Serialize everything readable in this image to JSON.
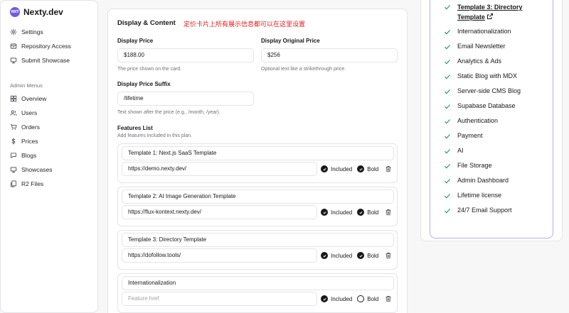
{
  "brand": {
    "name": "Nexty.dev",
    "logo_text": "NXT"
  },
  "sidebar": {
    "top_items": [
      {
        "label": "Settings",
        "icon": "gear-icon"
      },
      {
        "label": "Repository Access",
        "icon": "box-icon"
      },
      {
        "label": "Submit Showcase",
        "icon": "monitor-icon"
      }
    ],
    "section_label": "Admin Menus",
    "admin_items": [
      {
        "label": "Overview",
        "icon": "grid-icon"
      },
      {
        "label": "Users",
        "icon": "users-icon"
      },
      {
        "label": "Orders",
        "icon": "cart-icon"
      },
      {
        "label": "Prices",
        "icon": "dollar-icon"
      },
      {
        "label": "Blogs",
        "icon": "chat-icon"
      },
      {
        "label": "Showcases",
        "icon": "monitor-icon"
      },
      {
        "label": "R2 Files",
        "icon": "files-icon"
      }
    ]
  },
  "card": {
    "title": "Display & Content",
    "note": "定价卡片上所有展示信息都可以在这里设置",
    "display_price": {
      "label": "Display Price",
      "value": "$188.00",
      "help": "The price shown on the card."
    },
    "display_original_price": {
      "label": "Display Original Price",
      "value": "$256",
      "help": "Optional text like a strikethrough price."
    },
    "price_suffix": {
      "label": "Display Price Suffix",
      "value": "/lifetime",
      "help": "Text shown after the price (e.g., /month, /year)."
    },
    "features": {
      "label": "Features List",
      "help": "Add features included in this plan.",
      "included_label": "Included",
      "bold_label": "Bold",
      "href_placeholder": "Feature href",
      "items": [
        {
          "title": "Template 1: Next.js SaaS Template",
          "href": "https://demo.nexty.dev/",
          "included": true,
          "bold": true
        },
        {
          "title": "Template 2: AI Image Generation Template",
          "href": "https://flux-kontext.nexty.dev/",
          "included": true,
          "bold": true
        },
        {
          "title": "Template 3: Directory Template",
          "href": "https://dofollow.tools/",
          "included": true,
          "bold": true
        },
        {
          "title": "Internationalization",
          "href": "",
          "included": true,
          "bold": false
        }
      ]
    }
  },
  "preview": {
    "link_feature": "Template 3: Directory Template",
    "features": [
      "Internationalization",
      "Email Newsletter",
      "Analytics & Ads",
      "Static Blog with MDX",
      "Server-side CMS Blog",
      "Supabase Database",
      "Authentication",
      "Payment",
      "AI",
      "File Storage",
      "Admin Dashboard",
      "Lifetime license",
      "24/7 Email Support"
    ],
    "check_color": "#22a35a",
    "accent_color": "#b7adf0"
  }
}
